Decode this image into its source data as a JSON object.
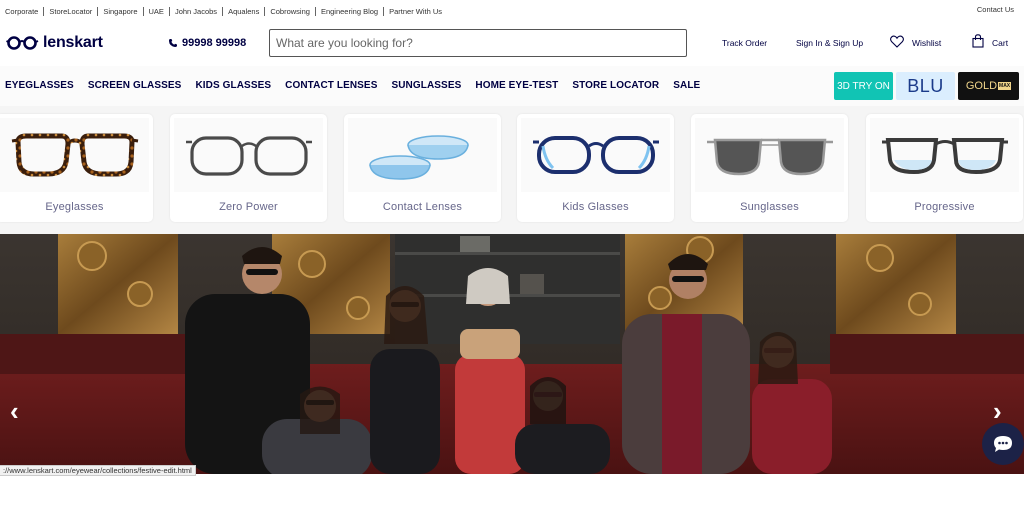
{
  "topbar": {
    "links": [
      "Corporate",
      "StoreLocator",
      "Singapore",
      "UAE",
      "John Jacobs",
      "Aqualens",
      "Cobrowsing",
      "Engineering Blog",
      "Partner With Us"
    ],
    "contact": "Contact Us"
  },
  "header": {
    "logo": "lenskart",
    "phone": "99998 99998",
    "search_placeholder": "What are you looking for?",
    "track_order": "Track Order",
    "signin": "Sign In & Sign Up",
    "wishlist": "Wishlist",
    "cart": "Cart"
  },
  "nav": {
    "items": [
      "EYEGLASSES",
      "SCREEN GLASSES",
      "KIDS GLASSES",
      "CONTACT LENSES",
      "SUNGLASSES",
      "HOME EYE-TEST",
      "STORE LOCATOR",
      "SALE"
    ],
    "tryon": "3D TRY ON",
    "blu": "BLU",
    "gold": "GOLD",
    "gold_badge": "MAX"
  },
  "categories": [
    "Eyeglasses",
    "Zero Power",
    "Contact Lenses",
    "Kids Glasses",
    "Sunglasses",
    "Progressive"
  ],
  "hero": {
    "prev": "‹",
    "next": "›"
  },
  "status_url": "://www.lenskart.com/eyewear/collections/festive-edit.html",
  "colors": {
    "brand": "#000042",
    "tryon": "#11c4b4",
    "blu_bg": "#dbeefe",
    "gold_bg": "#111111"
  },
  "icons": [
    "glasses-logo-icon",
    "phone-icon",
    "heart-icon",
    "bag-icon",
    "chat-icon"
  ]
}
